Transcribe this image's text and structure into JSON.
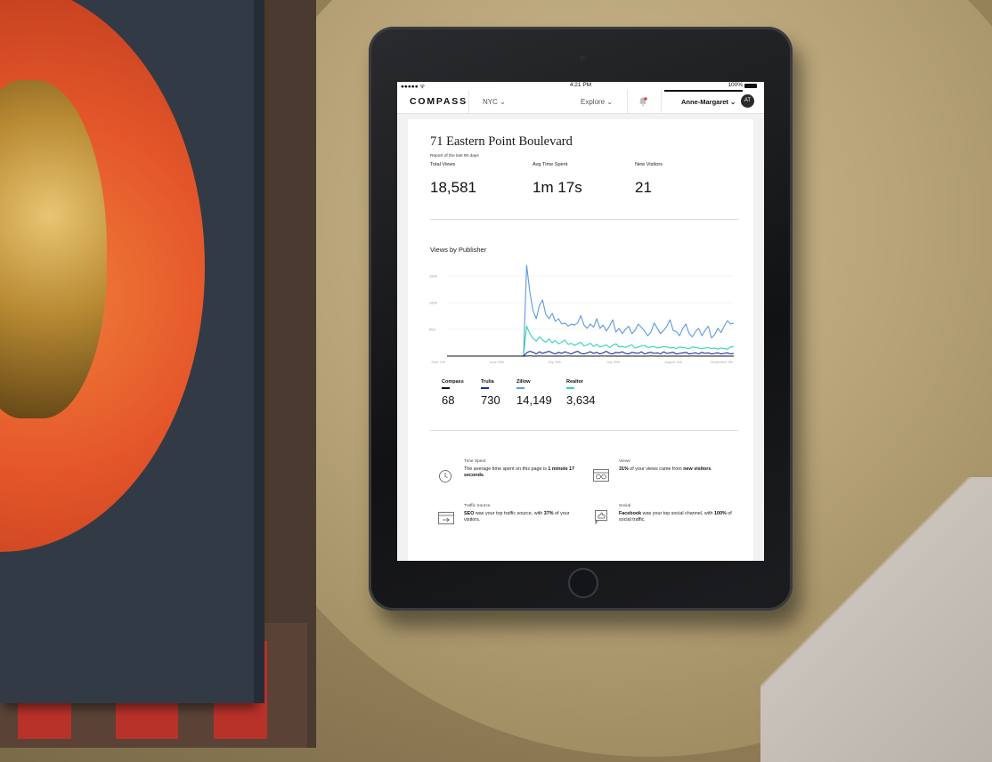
{
  "device": {
    "status_carrier": "●●●●● ᯤ",
    "status_time": "4:21 PM",
    "status_battery": "100%"
  },
  "header": {
    "logo": "COMPASS",
    "city": "NYC ⌄",
    "explore": "Explore ⌄",
    "user_name": "Anne-Margaret ⌄",
    "user_initials": "AT"
  },
  "property": {
    "title": "71 Eastern Point Boulevard",
    "report_label": "Report of the last 90 days"
  },
  "stats": [
    {
      "label": "Total Views",
      "value": "18,581"
    },
    {
      "label": "Avg Time Spent",
      "value": "1m 17s"
    },
    {
      "label": "New Visitors",
      "value": "21"
    }
  ],
  "chart_section_title": "Views by Publisher",
  "chart_data": {
    "type": "line",
    "title": "Views by Publisher",
    "x_tick_labels": [
      "June 11th",
      "June 26th",
      "July 10th",
      "July 30th",
      "August 11th",
      "September 8th"
    ],
    "y_tick_labels": [
      "500",
      "1000",
      "1500"
    ],
    "ylim": [
      0,
      1800
    ],
    "grid": true,
    "legend": "bottom",
    "x_index_range": [
      0,
      90
    ],
    "series": [
      {
        "name": "Zillow",
        "color": "#5b9be6",
        "values": [
          0,
          0,
          0,
          0,
          0,
          0,
          0,
          0,
          0,
          0,
          0,
          0,
          0,
          0,
          0,
          0,
          0,
          0,
          0,
          0,
          0,
          0,
          0,
          0,
          0,
          1700,
          1200,
          850,
          700,
          950,
          1050,
          780,
          700,
          800,
          650,
          700,
          600,
          620,
          560,
          600,
          580,
          620,
          760,
          580,
          520,
          600,
          540,
          700,
          520,
          580,
          470,
          560,
          680,
          450,
          520,
          420,
          500,
          560,
          420,
          480,
          600,
          540,
          470,
          380,
          450,
          620,
          520,
          420,
          480,
          560,
          680,
          480,
          460,
          380,
          520,
          600,
          420,
          360,
          460,
          520,
          380,
          480,
          560,
          340,
          400,
          520,
          440,
          560,
          660,
          600,
          620
        ]
      },
      {
        "name": "Realtor",
        "color": "#2fd6b4",
        "values": [
          0,
          0,
          0,
          0,
          0,
          0,
          0,
          0,
          0,
          0,
          0,
          0,
          0,
          0,
          0,
          0,
          0,
          0,
          0,
          0,
          0,
          0,
          0,
          0,
          0,
          560,
          420,
          330,
          280,
          360,
          300,
          260,
          320,
          250,
          290,
          230,
          260,
          300,
          220,
          240,
          200,
          230,
          260,
          190,
          210,
          240,
          180,
          220,
          170,
          190,
          210,
          160,
          200,
          230,
          170,
          180,
          160,
          190,
          210,
          150,
          170,
          190,
          200,
          160,
          170,
          180,
          150,
          160,
          180,
          170,
          150,
          160,
          140,
          170,
          160,
          150,
          140,
          170,
          160,
          150,
          140,
          150,
          160,
          140,
          150,
          130,
          150,
          140,
          130,
          170,
          180
        ]
      },
      {
        "name": "Trulia",
        "color": "#1c2ea3",
        "values": [
          0,
          0,
          0,
          0,
          0,
          0,
          0,
          0,
          0,
          0,
          0,
          0,
          0,
          0,
          0,
          0,
          0,
          0,
          0,
          0,
          0,
          0,
          0,
          0,
          0,
          60,
          90,
          70,
          40,
          80,
          50,
          70,
          90,
          60,
          40,
          70,
          50,
          80,
          60,
          40,
          70,
          90,
          50,
          40,
          60,
          80,
          50,
          70,
          40,
          60,
          90,
          50,
          40,
          70,
          60,
          80,
          50,
          40,
          70,
          60,
          50,
          80,
          40,
          60,
          70,
          50,
          60,
          40,
          80,
          50,
          60,
          70,
          40,
          50,
          60,
          70,
          40,
          50,
          60,
          40,
          70,
          50,
          60,
          40,
          50,
          60,
          40,
          50,
          60,
          40,
          50
        ]
      },
      {
        "name": "Compass",
        "color": "#111111",
        "values": [
          0,
          0,
          0,
          0,
          0,
          0,
          0,
          0,
          0,
          0,
          0,
          0,
          0,
          0,
          0,
          0,
          0,
          0,
          0,
          0,
          0,
          0,
          0,
          0,
          0,
          0,
          5,
          0,
          0,
          3,
          0,
          0,
          0,
          2,
          0,
          0,
          0,
          0,
          4,
          0,
          0,
          0,
          0,
          0,
          1,
          0,
          0,
          0,
          0,
          3,
          0,
          0,
          0,
          0,
          0,
          0,
          2,
          0,
          0,
          0,
          0,
          0,
          0,
          0,
          3,
          0,
          0,
          0,
          0,
          0,
          2,
          0,
          0,
          0,
          0,
          0,
          0,
          3,
          0,
          0,
          0,
          0,
          0,
          2,
          0,
          0,
          0,
          0,
          0,
          0,
          0
        ]
      }
    ]
  },
  "legend_totals": [
    {
      "name": "Compass",
      "value": "68",
      "color": "#111111"
    },
    {
      "name": "Trulia",
      "value": "730",
      "color": "#1c2ea3"
    },
    {
      "name": "Zillow",
      "value": "14,149",
      "color": "#5b9be6"
    },
    {
      "name": "Realtor",
      "value": "3,634",
      "color": "#2fd6b4"
    }
  ],
  "insights": {
    "time_spent": {
      "title": "Time Spent",
      "pre": "The average time spent on this page is ",
      "bold": "1 minute 17 seconds",
      "post": "."
    },
    "views": {
      "title": "Views",
      "bold1": "31%",
      "mid": " of your views came from ",
      "bold2": "new visitors",
      "post": "."
    },
    "traffic": {
      "title": "Traffic Source",
      "bold1": "SEO",
      "mid": " was your top traffic source, with ",
      "bold2": "37%",
      "post": " of your visitors."
    },
    "social": {
      "title": "Social",
      "bold1": "Facebook",
      "mid": " was your top social channel, with ",
      "bold2": "100%",
      "post": " of social traffic."
    }
  }
}
